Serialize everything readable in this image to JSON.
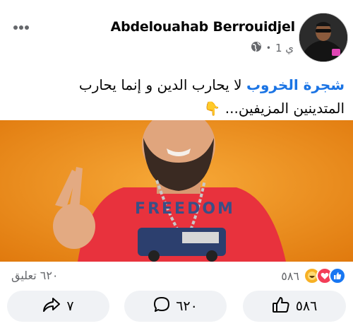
{
  "post": {
    "author_name": "Abdelouahab Berrouidjel",
    "time": "1 ي",
    "separator": "•",
    "privacy_icon": "globe-icon",
    "menu_icon": "more-dots-icon",
    "text": {
      "tag": "شجرة الخروب",
      "body": " لا يحارب الدين و إنما يحارب المتدينين المزيفين...",
      "emoji": "👇"
    },
    "photo": {
      "shirt_text": "FREEDOM",
      "background_color": "#f0961e",
      "shirt_color": "#e8323d"
    }
  },
  "stats": {
    "reaction_count": "٥٨٦",
    "reaction_icons": [
      "like-icon",
      "love-icon",
      "haha-icon"
    ],
    "comments": "٦٢٠ تعليق"
  },
  "actions": {
    "share_count": "٧",
    "comment_count": "٦٢٠",
    "like_count": "٥٨٦"
  },
  "colors": {
    "link": "#1b74e4",
    "muted": "#65676b",
    "button_bg": "#f0f2f5"
  }
}
